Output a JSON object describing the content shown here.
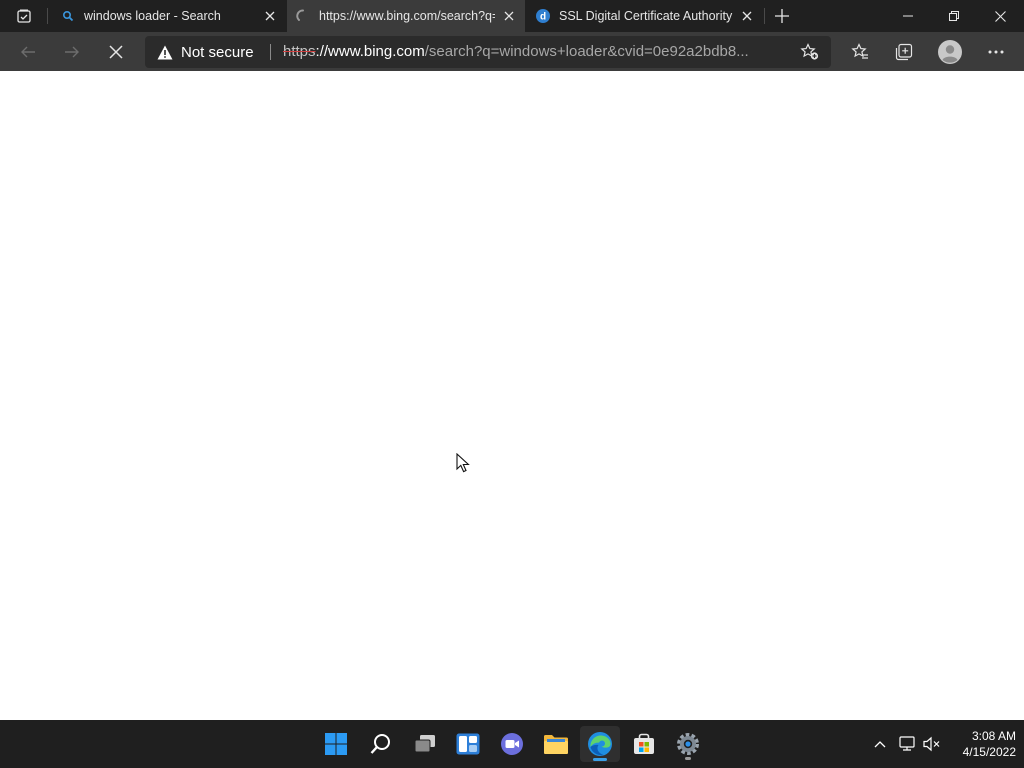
{
  "browser": {
    "tabs": [
      {
        "title": "windows loader - Search",
        "favicon": "bing-search-icon",
        "active": false
      },
      {
        "title": "https://www.bing.com/search?q=",
        "favicon": "loading-spinner-icon",
        "active": true
      },
      {
        "title": "SSL Digital Certificate Authority -",
        "favicon": "digicert-d-icon",
        "active": false
      }
    ],
    "address_bar": {
      "security_label": "Not secure",
      "url_scheme": "https",
      "url_host": "://www.bing.com",
      "url_rest": "/search?q=windows+loader&cvid=0e92a2bdb8..."
    }
  },
  "taskbar": {
    "icons": [
      "start-icon",
      "search-icon",
      "task-view-icon",
      "widgets-icon",
      "chat-icon",
      "file-explorer-icon",
      "edge-icon",
      "store-icon",
      "settings-icon"
    ],
    "clock": {
      "time": "3:08 AM",
      "date": "4/15/2022"
    }
  }
}
